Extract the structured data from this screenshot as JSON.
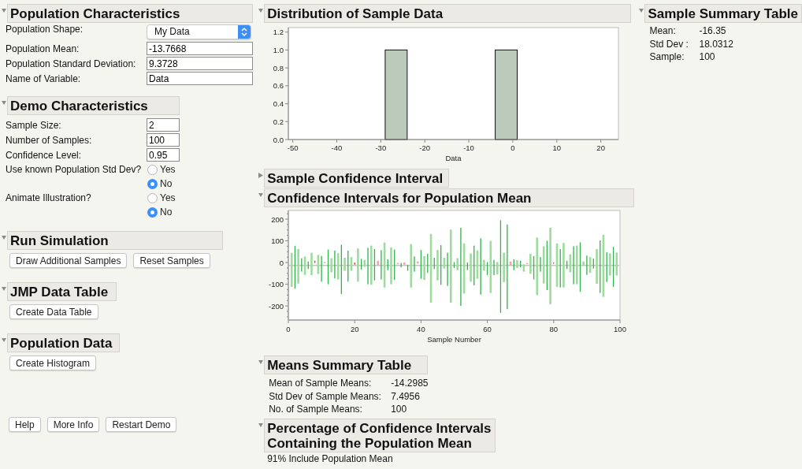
{
  "population_characteristics": {
    "title": "Population Characteristics",
    "expanded": true,
    "shape": {
      "label": "Population Shape:",
      "value": "My Data"
    },
    "fields": [
      {
        "label": "Population Mean:",
        "value": "-13.7668"
      },
      {
        "label": "Population Standard Deviation:",
        "value": "9.3728"
      },
      {
        "label": "Name of Variable:",
        "value": "Data"
      }
    ]
  },
  "demo_characteristics": {
    "title": "Demo Characteristics",
    "expanded": true,
    "fields": [
      {
        "label": "Sample Size:",
        "value": "2"
      },
      {
        "label": "Number of Samples:",
        "value": "100"
      },
      {
        "label": "Confidence Level:",
        "value": "0.95"
      }
    ],
    "radio_groups": [
      {
        "label": "Use known Population Std Dev?",
        "options": [
          {
            "label": "Yes",
            "selected": false
          },
          {
            "label": "No",
            "selected": true
          }
        ]
      },
      {
        "label": "Animate Illustration?",
        "options": [
          {
            "label": "Yes",
            "selected": false
          },
          {
            "label": "No",
            "selected": true
          }
        ]
      }
    ]
  },
  "run_simulation": {
    "title": "Run Simulation",
    "expanded": true,
    "buttons": [
      "Draw Additional Samples",
      "Reset Samples"
    ]
  },
  "jmp_data_table": {
    "title": "JMP Data Table",
    "expanded": true,
    "buttons": [
      "Create Data Table"
    ]
  },
  "population_data": {
    "title": "Population Data",
    "expanded": true,
    "buttons": [
      "Create Histogram"
    ]
  },
  "footer_buttons": [
    "Help",
    "More Info",
    "Restart Demo"
  ],
  "distribution_of_sample_data": {
    "title": "Distribution of Sample Data",
    "expanded": true,
    "chart_data": {
      "type": "bar",
      "xlabel": "Data",
      "x": [
        -26.5,
        -1.5
      ],
      "values": [
        1,
        1
      ],
      "xlim": [
        -51,
        24
      ],
      "ylim": [
        0,
        1.25
      ],
      "xticks": [
        -50,
        -40,
        -30,
        -20,
        -10,
        0,
        10,
        20
      ],
      "yticks": [
        {
          "value": 0,
          "label": "0.0"
        },
        {
          "value": 0.2,
          "label": "0.2"
        },
        {
          "value": 0.4,
          "label": "0.4"
        },
        {
          "value": 0.6,
          "label": "0.6"
        },
        {
          "value": 0.8,
          "label": "0.8"
        },
        {
          "value": 1,
          "label": "1.0"
        },
        {
          "value": 1.2,
          "label": "1.2"
        }
      ]
    }
  },
  "sample_confidence_interval": {
    "title": "Sample Confidence Interval",
    "expanded": false
  },
  "confidence_intervals": {
    "title": "Confidence Intervals for Population Mean",
    "expanded": true,
    "plot": {
      "y_tick_labels": [
        "200",
        "100",
        "0",
        "-100",
        "-200"
      ],
      "x_tick_labels": [
        "0",
        "20",
        "40",
        "60",
        "80",
        "100"
      ],
      "x_axis_title": "Sample Number"
    }
  },
  "means_summary_table": {
    "title": "Means Summary Table",
    "expanded": true,
    "rows": [
      {
        "label": "Mean of Sample Means:",
        "value": "-14.2985"
      },
      {
        "label": "Std Dev of Sample Means:",
        "value": "7.4956"
      },
      {
        "label": "No. of Sample Means:",
        "value": "100"
      }
    ]
  },
  "percentage_contained": {
    "title_lines": [
      "Percentage of Confidence Intervals",
      "Containing the Population Mean"
    ],
    "expanded": true,
    "text": "91% Include Population Mean"
  },
  "sample_summary_table": {
    "title": "Sample Summary Table",
    "expanded": true,
    "rows": [
      {
        "label": "Mean:",
        "value": "-16.35"
      },
      {
        "label": "Std Dev :",
        "value": "18.0312"
      },
      {
        "label": "Sample:",
        "value": "100"
      }
    ]
  }
}
